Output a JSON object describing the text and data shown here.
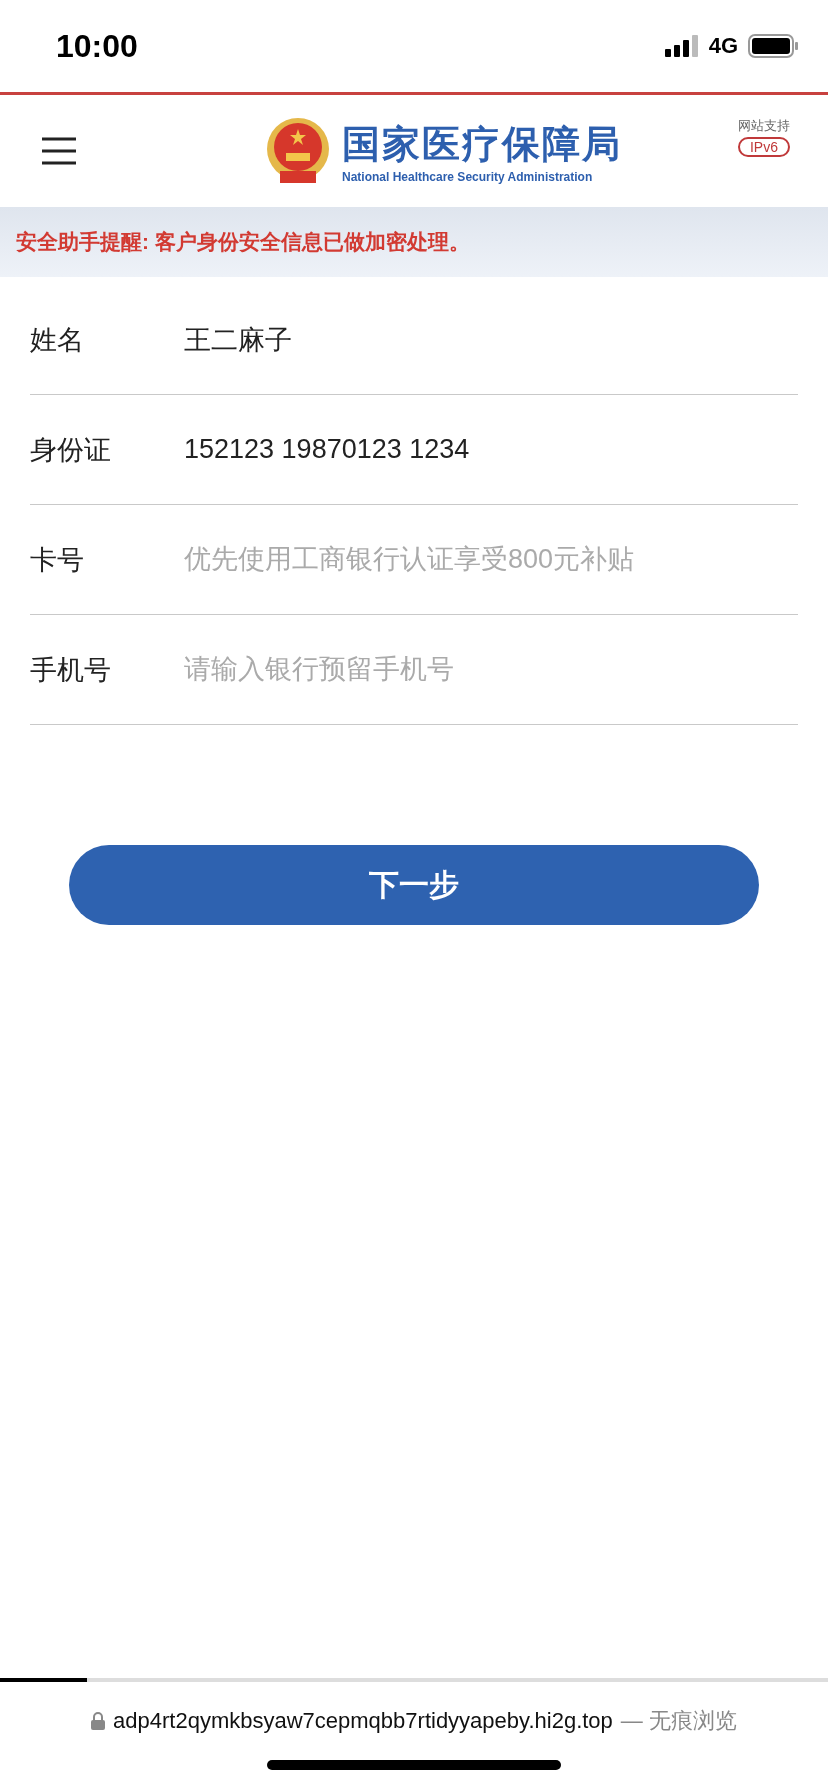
{
  "status_bar": {
    "time": "10:00",
    "network": "4G"
  },
  "header": {
    "title": "国家医疗保障局",
    "subtitle": "National Healthcare Security Administration",
    "support_label": "网站支持",
    "support_badge": "IPv6"
  },
  "notice": "安全助手提醒: 客户身份安全信息已做加密处理。",
  "fields": [
    {
      "label": "姓名",
      "value": "王二麻子"
    },
    {
      "label": "身份证",
      "value": "152123 19870123 1234"
    },
    {
      "label": "卡号",
      "placeholder": "优先使用工商银行认证享受800元补贴"
    },
    {
      "label": "手机号",
      "placeholder": "请输入银行预留手机号"
    }
  ],
  "next_button": "下一步",
  "browser_bar": {
    "level": 0.105,
    "url": "adp4rt2qymkbsyaw7cepmqbb7rtidyyapeby.hi2g.top",
    "mode": "— 无痕浏览"
  }
}
